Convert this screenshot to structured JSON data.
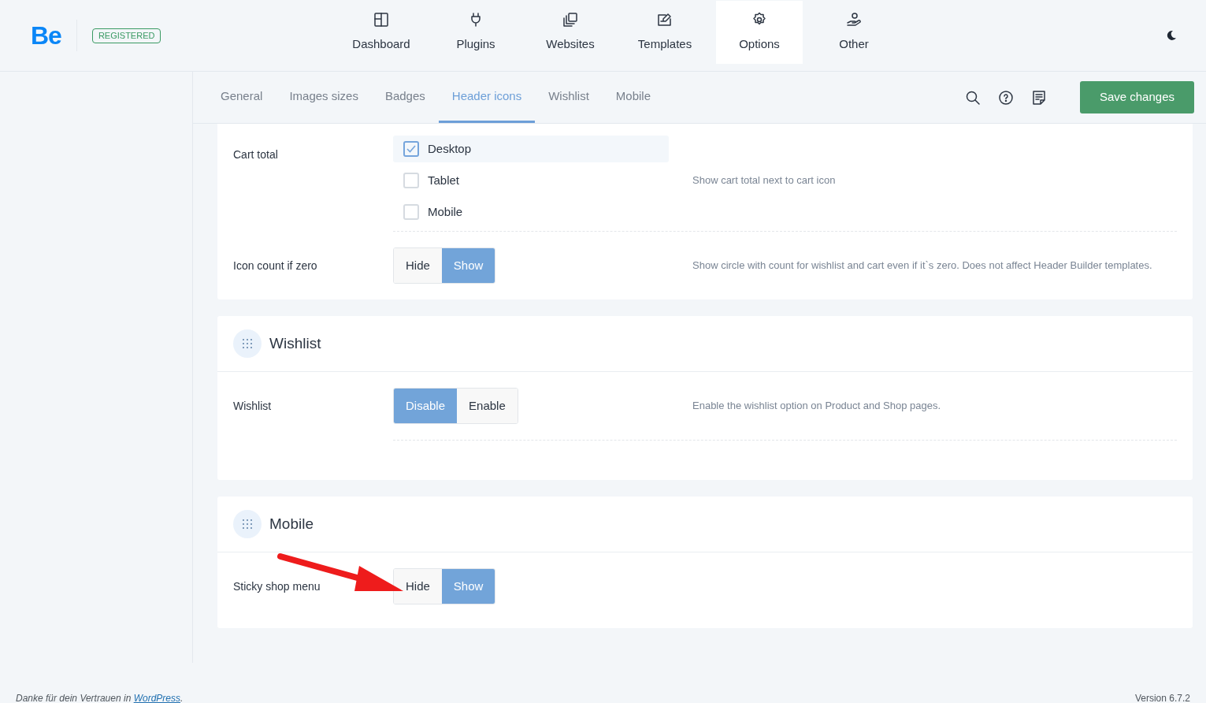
{
  "header": {
    "logo": "Be",
    "badge": "REGISTERED",
    "nav": [
      {
        "label": "Dashboard",
        "kind": "dashboard",
        "selected": false
      },
      {
        "label": "Plugins",
        "kind": "plugins",
        "selected": false
      },
      {
        "label": "Websites",
        "kind": "websites",
        "selected": false
      },
      {
        "label": "Templates",
        "kind": "templates",
        "selected": false
      },
      {
        "label": "Options",
        "kind": "options",
        "selected": true
      },
      {
        "label": "Other",
        "kind": "other",
        "selected": false
      }
    ]
  },
  "subnav": {
    "tabs": [
      {
        "label": "General",
        "selected": false
      },
      {
        "label": "Images sizes",
        "selected": false
      },
      {
        "label": "Badges",
        "selected": false
      },
      {
        "label": "Header icons",
        "selected": true
      },
      {
        "label": "Wishlist",
        "selected": false
      },
      {
        "label": "Mobile",
        "selected": false
      }
    ],
    "save_button": "Save changes"
  },
  "cards": [
    {
      "rows": [
        {
          "kind": "checkboxes",
          "label": "Cart total",
          "description": "Show cart total next to cart icon",
          "options": [
            {
              "label": "Desktop",
              "checked": true
            },
            {
              "label": "Tablet",
              "checked": false
            },
            {
              "label": "Mobile",
              "checked": false
            }
          ]
        },
        {
          "kind": "segmented",
          "label": "Icon count if zero",
          "description": "Show circle with count for wishlist and cart even if it`s zero. Does not affect Header Builder templates.",
          "options": [
            {
              "label": "Hide",
              "selected": false
            },
            {
              "label": "Show",
              "selected": true
            }
          ]
        }
      ]
    },
    {
      "title": "Wishlist",
      "rows": [
        {
          "kind": "segmented",
          "label": "Wishlist",
          "description": "Enable the wishlist option on Product and Shop pages.",
          "options": [
            {
              "label": "Disable",
              "selected": true
            },
            {
              "label": "Enable",
              "selected": false
            }
          ]
        }
      ]
    },
    {
      "title": "Mobile",
      "rows": [
        {
          "kind": "segmented",
          "label": "Sticky shop menu",
          "options": [
            {
              "label": "Hide",
              "selected": false
            },
            {
              "label": "Show",
              "selected": true
            }
          ]
        }
      ]
    }
  ],
  "footer": {
    "thanks_before": "Danke für dein Vertrauen in ",
    "thanks_link": "WordPress",
    "thanks_after": ".",
    "version": "Version 6.7.2"
  }
}
